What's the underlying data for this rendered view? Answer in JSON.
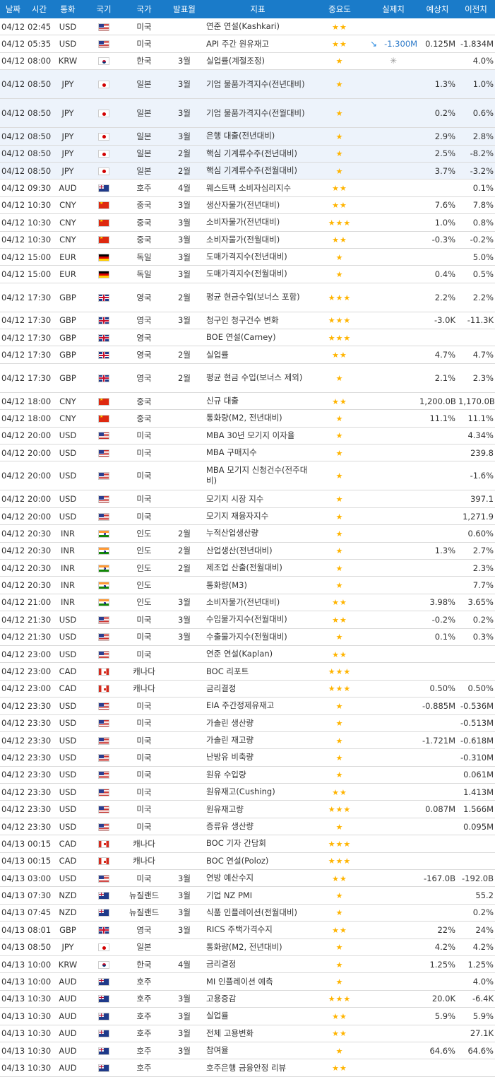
{
  "headers": {
    "date": "날짜",
    "time": "시간",
    "currency": "통화",
    "flag": "국기",
    "country": "국가",
    "period": "발표월",
    "indicator": "지표",
    "importance": "중요도",
    "actual": "실제치",
    "forecast": "예상치",
    "previous": "이전치"
  },
  "rows": [
    {
      "date": "04/12",
      "time": "02:45",
      "currency": "USD",
      "flag": "us",
      "country": "미국",
      "period": "",
      "indicator": "연준 연설(Kashkari)",
      "importance": 2,
      "actual": "",
      "forecast": "",
      "previous": "",
      "arrow": "",
      "pending": false
    },
    {
      "date": "04/12",
      "time": "05:35",
      "currency": "USD",
      "flag": "us",
      "country": "미국",
      "period": "",
      "indicator": "API 주간 원유재고",
      "importance": 2,
      "actual": "-1.300M",
      "forecast": "0.125M",
      "previous": "-1.834M",
      "arrow": "down",
      "pending": false
    },
    {
      "date": "04/12",
      "time": "08:00",
      "currency": "KRW",
      "flag": "kr",
      "country": "한국",
      "period": "3월",
      "indicator": "실업률(계절조정)",
      "importance": 1,
      "actual": "",
      "forecast": "",
      "previous": "4.0%",
      "arrow": "",
      "pending": true
    },
    {
      "date": "04/12",
      "time": "08:50",
      "currency": "JPY",
      "flag": "jp",
      "country": "일본",
      "period": "3월",
      "indicator": "기업 물품가격지수(전년대비)",
      "importance": 1,
      "actual": "",
      "forecast": "1.3%",
      "previous": "1.0%",
      "arrow": "",
      "pending": false,
      "hl": true,
      "tall": true
    },
    {
      "date": "04/12",
      "time": "08:50",
      "currency": "JPY",
      "flag": "jp",
      "country": "일본",
      "period": "3월",
      "indicator": "기업 물품가격지수(전월대비)",
      "importance": 1,
      "actual": "",
      "forecast": "0.2%",
      "previous": "0.6%",
      "arrow": "",
      "pending": false,
      "hl": true,
      "tall": true
    },
    {
      "date": "04/12",
      "time": "08:50",
      "currency": "JPY",
      "flag": "jp",
      "country": "일본",
      "period": "3월",
      "indicator": "은행 대출(전년대비)",
      "importance": 1,
      "actual": "",
      "forecast": "2.9%",
      "previous": "2.8%",
      "arrow": "",
      "pending": false,
      "hl": true
    },
    {
      "date": "04/12",
      "time": "08:50",
      "currency": "JPY",
      "flag": "jp",
      "country": "일본",
      "period": "2월",
      "indicator": "핵심 기계류수주(전년대비)",
      "importance": 1,
      "actual": "",
      "forecast": "2.5%",
      "previous": "-8.2%",
      "arrow": "",
      "pending": false,
      "hl": true
    },
    {
      "date": "04/12",
      "time": "08:50",
      "currency": "JPY",
      "flag": "jp",
      "country": "일본",
      "period": "2월",
      "indicator": "핵심 기계류수주(전월대비)",
      "importance": 1,
      "actual": "",
      "forecast": "3.7%",
      "previous": "-3.2%",
      "arrow": "",
      "pending": false,
      "hl": true
    },
    {
      "date": "04/12",
      "time": "09:30",
      "currency": "AUD",
      "flag": "au",
      "country": "호주",
      "period": "4월",
      "indicator": "웨스트팩 소비자심리지수",
      "importance": 2,
      "actual": "",
      "forecast": "",
      "previous": "0.1%",
      "arrow": "",
      "pending": false
    },
    {
      "date": "04/12",
      "time": "10:30",
      "currency": "CNY",
      "flag": "cn",
      "country": "중국",
      "period": "3월",
      "indicator": "생산자물가(전년대비)",
      "importance": 2,
      "actual": "",
      "forecast": "7.6%",
      "previous": "7.8%",
      "arrow": "",
      "pending": false
    },
    {
      "date": "04/12",
      "time": "10:30",
      "currency": "CNY",
      "flag": "cn",
      "country": "중국",
      "period": "3월",
      "indicator": "소비자물가(전년대비)",
      "importance": 3,
      "actual": "",
      "forecast": "1.0%",
      "previous": "0.8%",
      "arrow": "",
      "pending": false
    },
    {
      "date": "04/12",
      "time": "10:30",
      "currency": "CNY",
      "flag": "cn",
      "country": "중국",
      "period": "3월",
      "indicator": "소비자물가(전월대비)",
      "importance": 2,
      "actual": "",
      "forecast": "-0.3%",
      "previous": "-0.2%",
      "arrow": "",
      "pending": false
    },
    {
      "date": "04/12",
      "time": "15:00",
      "currency": "EUR",
      "flag": "de",
      "country": "독일",
      "period": "3월",
      "indicator": "도매가격지수(전년대비)",
      "importance": 1,
      "actual": "",
      "forecast": "",
      "previous": "5.0%",
      "arrow": "",
      "pending": false
    },
    {
      "date": "04/12",
      "time": "15:00",
      "currency": "EUR",
      "flag": "de",
      "country": "독일",
      "period": "3월",
      "indicator": "도매가격지수(전월대비)",
      "importance": 1,
      "actual": "",
      "forecast": "0.4%",
      "previous": "0.5%",
      "arrow": "",
      "pending": false
    },
    {
      "date": "04/12",
      "time": "17:30",
      "currency": "GBP",
      "flag": "gb",
      "country": "영국",
      "period": "2월",
      "indicator": "평균 현금수입(보너스 포함)",
      "importance": 3,
      "actual": "",
      "forecast": "2.2%",
      "previous": "2.2%",
      "arrow": "",
      "pending": false,
      "tall": true
    },
    {
      "date": "04/12",
      "time": "17:30",
      "currency": "GBP",
      "flag": "gb",
      "country": "영국",
      "period": "3월",
      "indicator": "청구인 청구건수 변화",
      "importance": 3,
      "actual": "",
      "forecast": "-3.0K",
      "previous": "-11.3K",
      "arrow": "",
      "pending": false
    },
    {
      "date": "04/12",
      "time": "17:30",
      "currency": "GBP",
      "flag": "gb",
      "country": "영국",
      "period": "",
      "indicator": "BOE 연설(Carney)",
      "importance": 3,
      "actual": "",
      "forecast": "",
      "previous": "",
      "arrow": "",
      "pending": false
    },
    {
      "date": "04/12",
      "time": "17:30",
      "currency": "GBP",
      "flag": "gb",
      "country": "영국",
      "period": "2월",
      "indicator": "실업률",
      "importance": 2,
      "actual": "",
      "forecast": "4.7%",
      "previous": "4.7%",
      "arrow": "",
      "pending": false
    },
    {
      "date": "04/12",
      "time": "17:30",
      "currency": "GBP",
      "flag": "gb",
      "country": "영국",
      "period": "2월",
      "indicator": "평균 현금 수입(보너스 제외)",
      "importance": 1,
      "actual": "",
      "forecast": "2.1%",
      "previous": "2.3%",
      "arrow": "",
      "pending": false,
      "tall": true
    },
    {
      "date": "04/12",
      "time": "18:00",
      "currency": "CNY",
      "flag": "cn",
      "country": "중국",
      "period": "",
      "indicator": "신규 대출",
      "importance": 2,
      "actual": "",
      "forecast": "1,200.0B",
      "previous": "1,170.0B",
      "arrow": "",
      "pending": false
    },
    {
      "date": "04/12",
      "time": "18:00",
      "currency": "CNY",
      "flag": "cn",
      "country": "중국",
      "period": "",
      "indicator": "통화량(M2, 전년대비)",
      "importance": 1,
      "actual": "",
      "forecast": "11.1%",
      "previous": "11.1%",
      "arrow": "",
      "pending": false
    },
    {
      "date": "04/12",
      "time": "20:00",
      "currency": "USD",
      "flag": "us",
      "country": "미국",
      "period": "",
      "indicator": "MBA 30년 모기지 이자율",
      "importance": 1,
      "actual": "",
      "forecast": "",
      "previous": "4.34%",
      "arrow": "",
      "pending": false
    },
    {
      "date": "04/12",
      "time": "20:00",
      "currency": "USD",
      "flag": "us",
      "country": "미국",
      "period": "",
      "indicator": "MBA 구매지수",
      "importance": 1,
      "actual": "",
      "forecast": "",
      "previous": "239.8",
      "arrow": "",
      "pending": false
    },
    {
      "date": "04/12",
      "time": "20:00",
      "currency": "USD",
      "flag": "us",
      "country": "미국",
      "period": "",
      "indicator": "MBA 모기지 신청건수(전주대비)",
      "importance": 1,
      "actual": "",
      "forecast": "",
      "previous": "-1.6%",
      "arrow": "",
      "pending": false,
      "tall": true
    },
    {
      "date": "04/12",
      "time": "20:00",
      "currency": "USD",
      "flag": "us",
      "country": "미국",
      "period": "",
      "indicator": "모기지 시장 지수",
      "importance": 1,
      "actual": "",
      "forecast": "",
      "previous": "397.1",
      "arrow": "",
      "pending": false
    },
    {
      "date": "04/12",
      "time": "20:00",
      "currency": "USD",
      "flag": "us",
      "country": "미국",
      "period": "",
      "indicator": "모기지 재융자지수",
      "importance": 1,
      "actual": "",
      "forecast": "",
      "previous": "1,271.9",
      "arrow": "",
      "pending": false
    },
    {
      "date": "04/12",
      "time": "20:30",
      "currency": "INR",
      "flag": "in",
      "country": "인도",
      "period": "2월",
      "indicator": "누적산업생산량",
      "importance": 1,
      "actual": "",
      "forecast": "",
      "previous": "0.60%",
      "arrow": "",
      "pending": false
    },
    {
      "date": "04/12",
      "time": "20:30",
      "currency": "INR",
      "flag": "in",
      "country": "인도",
      "period": "2월",
      "indicator": "산업생산(전년대비)",
      "importance": 1,
      "actual": "",
      "forecast": "1.3%",
      "previous": "2.7%",
      "arrow": "",
      "pending": false
    },
    {
      "date": "04/12",
      "time": "20:30",
      "currency": "INR",
      "flag": "in",
      "country": "인도",
      "period": "2월",
      "indicator": "제조업 산출(전월대비)",
      "importance": 1,
      "actual": "",
      "forecast": "",
      "previous": "2.3%",
      "arrow": "",
      "pending": false
    },
    {
      "date": "04/12",
      "time": "20:30",
      "currency": "INR",
      "flag": "in",
      "country": "인도",
      "period": "",
      "indicator": "통화량(M3)",
      "importance": 1,
      "actual": "",
      "forecast": "",
      "previous": "7.7%",
      "arrow": "",
      "pending": false
    },
    {
      "date": "04/12",
      "time": "21:00",
      "currency": "INR",
      "flag": "in",
      "country": "인도",
      "period": "3월",
      "indicator": "소비자물가(전년대비)",
      "importance": 2,
      "actual": "",
      "forecast": "3.98%",
      "previous": "3.65%",
      "arrow": "",
      "pending": false
    },
    {
      "date": "04/12",
      "time": "21:30",
      "currency": "USD",
      "flag": "us",
      "country": "미국",
      "period": "3월",
      "indicator": "수입물가지수(전월대비)",
      "importance": 2,
      "actual": "",
      "forecast": "-0.2%",
      "previous": "0.2%",
      "arrow": "",
      "pending": false
    },
    {
      "date": "04/12",
      "time": "21:30",
      "currency": "USD",
      "flag": "us",
      "country": "미국",
      "period": "3월",
      "indicator": "수출물가지수(전월대비)",
      "importance": 1,
      "actual": "",
      "forecast": "0.1%",
      "previous": "0.3%",
      "arrow": "",
      "pending": false
    },
    {
      "date": "04/12",
      "time": "23:00",
      "currency": "USD",
      "flag": "us",
      "country": "미국",
      "period": "",
      "indicator": "연준 연설(Kaplan)",
      "importance": 2,
      "actual": "",
      "forecast": "",
      "previous": "",
      "arrow": "",
      "pending": false
    },
    {
      "date": "04/12",
      "time": "23:00",
      "currency": "CAD",
      "flag": "ca",
      "country": "캐나다",
      "period": "",
      "indicator": "BOC 리포트",
      "importance": 3,
      "actual": "",
      "forecast": "",
      "previous": "",
      "arrow": "",
      "pending": false
    },
    {
      "date": "04/12",
      "time": "23:00",
      "currency": "CAD",
      "flag": "ca",
      "country": "캐나다",
      "period": "",
      "indicator": "금리결정",
      "importance": 3,
      "actual": "",
      "forecast": "0.50%",
      "previous": "0.50%",
      "arrow": "",
      "pending": false
    },
    {
      "date": "04/12",
      "time": "23:30",
      "currency": "USD",
      "flag": "us",
      "country": "미국",
      "period": "",
      "indicator": "EIA 주간정제유재고",
      "importance": 1,
      "actual": "",
      "forecast": "-0.885M",
      "previous": "-0.536M",
      "arrow": "",
      "pending": false
    },
    {
      "date": "04/12",
      "time": "23:30",
      "currency": "USD",
      "flag": "us",
      "country": "미국",
      "period": "",
      "indicator": "가솔린 생산량",
      "importance": 1,
      "actual": "",
      "forecast": "",
      "previous": "-0.513M",
      "arrow": "",
      "pending": false
    },
    {
      "date": "04/12",
      "time": "23:30",
      "currency": "USD",
      "flag": "us",
      "country": "미국",
      "period": "",
      "indicator": "가솔린 재고량",
      "importance": 1,
      "actual": "",
      "forecast": "-1.721M",
      "previous": "-0.618M",
      "arrow": "",
      "pending": false
    },
    {
      "date": "04/12",
      "time": "23:30",
      "currency": "USD",
      "flag": "us",
      "country": "미국",
      "period": "",
      "indicator": "난방유 비축량",
      "importance": 1,
      "actual": "",
      "forecast": "",
      "previous": "-0.310M",
      "arrow": "",
      "pending": false
    },
    {
      "date": "04/12",
      "time": "23:30",
      "currency": "USD",
      "flag": "us",
      "country": "미국",
      "period": "",
      "indicator": "원유 수입량",
      "importance": 1,
      "actual": "",
      "forecast": "",
      "previous": "0.061M",
      "arrow": "",
      "pending": false
    },
    {
      "date": "04/12",
      "time": "23:30",
      "currency": "USD",
      "flag": "us",
      "country": "미국",
      "period": "",
      "indicator": "원유재고(Cushing)",
      "importance": 2,
      "actual": "",
      "forecast": "",
      "previous": "1.413M",
      "arrow": "",
      "pending": false
    },
    {
      "date": "04/12",
      "time": "23:30",
      "currency": "USD",
      "flag": "us",
      "country": "미국",
      "period": "",
      "indicator": "원유재고량",
      "importance": 3,
      "actual": "",
      "forecast": "0.087M",
      "previous": "1.566M",
      "arrow": "",
      "pending": false
    },
    {
      "date": "04/12",
      "time": "23:30",
      "currency": "USD",
      "flag": "us",
      "country": "미국",
      "period": "",
      "indicator": "증류유 생산량",
      "importance": 1,
      "actual": "",
      "forecast": "",
      "previous": "0.095M",
      "arrow": "",
      "pending": false
    },
    {
      "date": "04/13",
      "time": "00:15",
      "currency": "CAD",
      "flag": "ca",
      "country": "캐나다",
      "period": "",
      "indicator": "BOC 기자 간담회",
      "importance": 3,
      "actual": "",
      "forecast": "",
      "previous": "",
      "arrow": "",
      "pending": false
    },
    {
      "date": "04/13",
      "time": "00:15",
      "currency": "CAD",
      "flag": "ca",
      "country": "캐나다",
      "period": "",
      "indicator": "BOC 연설(Poloz)",
      "importance": 3,
      "actual": "",
      "forecast": "",
      "previous": "",
      "arrow": "",
      "pending": false
    },
    {
      "date": "04/13",
      "time": "03:00",
      "currency": "USD",
      "flag": "us",
      "country": "미국",
      "period": "3월",
      "indicator": "연방 예산수지",
      "importance": 2,
      "actual": "",
      "forecast": "-167.0B",
      "previous": "-192.0B",
      "arrow": "",
      "pending": false
    },
    {
      "date": "04/13",
      "time": "07:30",
      "currency": "NZD",
      "flag": "nz",
      "country": "뉴질랜드",
      "period": "3월",
      "indicator": "기업 NZ PMI",
      "importance": 1,
      "actual": "",
      "forecast": "",
      "previous": "55.2",
      "arrow": "",
      "pending": false
    },
    {
      "date": "04/13",
      "time": "07:45",
      "currency": "NZD",
      "flag": "nz",
      "country": "뉴질랜드",
      "period": "3월",
      "indicator": "식품 인플레이션(전월대비)",
      "importance": 1,
      "actual": "",
      "forecast": "",
      "previous": "0.2%",
      "arrow": "",
      "pending": false
    },
    {
      "date": "04/13",
      "time": "08:01",
      "currency": "GBP",
      "flag": "gb",
      "country": "영국",
      "period": "3월",
      "indicator": "RICS 주택가격수지",
      "importance": 2,
      "actual": "",
      "forecast": "22%",
      "previous": "24%",
      "arrow": "",
      "pending": false
    },
    {
      "date": "04/13",
      "time": "08:50",
      "currency": "JPY",
      "flag": "jp",
      "country": "일본",
      "period": "",
      "indicator": "통화량(M2, 전년대비)",
      "importance": 1,
      "actual": "",
      "forecast": "4.2%",
      "previous": "4.2%",
      "arrow": "",
      "pending": false
    },
    {
      "date": "04/13",
      "time": "10:00",
      "currency": "KRW",
      "flag": "kr",
      "country": "한국",
      "period": "4월",
      "indicator": "금리결정",
      "importance": 1,
      "actual": "",
      "forecast": "1.25%",
      "previous": "1.25%",
      "arrow": "",
      "pending": false
    },
    {
      "date": "04/13",
      "time": "10:00",
      "currency": "AUD",
      "flag": "au",
      "country": "호주",
      "period": "",
      "indicator": "MI 인플레이션 예측",
      "importance": 1,
      "actual": "",
      "forecast": "",
      "previous": "4.0%",
      "arrow": "",
      "pending": false
    },
    {
      "date": "04/13",
      "time": "10:30",
      "currency": "AUD",
      "flag": "au",
      "country": "호주",
      "period": "3월",
      "indicator": "고용증감",
      "importance": 3,
      "actual": "",
      "forecast": "20.0K",
      "previous": "-6.4K",
      "arrow": "",
      "pending": false
    },
    {
      "date": "04/13",
      "time": "10:30",
      "currency": "AUD",
      "flag": "au",
      "country": "호주",
      "period": "3월",
      "indicator": "실업률",
      "importance": 2,
      "actual": "",
      "forecast": "5.9%",
      "previous": "5.9%",
      "arrow": "",
      "pending": false
    },
    {
      "date": "04/13",
      "time": "10:30",
      "currency": "AUD",
      "flag": "au",
      "country": "호주",
      "period": "3월",
      "indicator": "전체 고용변화",
      "importance": 2,
      "actual": "",
      "forecast": "",
      "previous": "27.1K",
      "arrow": "",
      "pending": false
    },
    {
      "date": "04/13",
      "time": "10:30",
      "currency": "AUD",
      "flag": "au",
      "country": "호주",
      "period": "3월",
      "indicator": "참여율",
      "importance": 1,
      "actual": "",
      "forecast": "64.6%",
      "previous": "64.6%",
      "arrow": "",
      "pending": false
    },
    {
      "date": "04/13",
      "time": "10:30",
      "currency": "AUD",
      "flag": "au",
      "country": "호주",
      "period": "",
      "indicator": "호주은행 금융안정 리뷰",
      "importance": 2,
      "actual": "",
      "forecast": "",
      "previous": "",
      "arrow": "",
      "pending": false
    }
  ],
  "colors": {
    "header_bg": "#1a7bc9",
    "star": "#ffb400",
    "actual_text": "#2a78c8",
    "highlight_row": "#edf3fb"
  }
}
